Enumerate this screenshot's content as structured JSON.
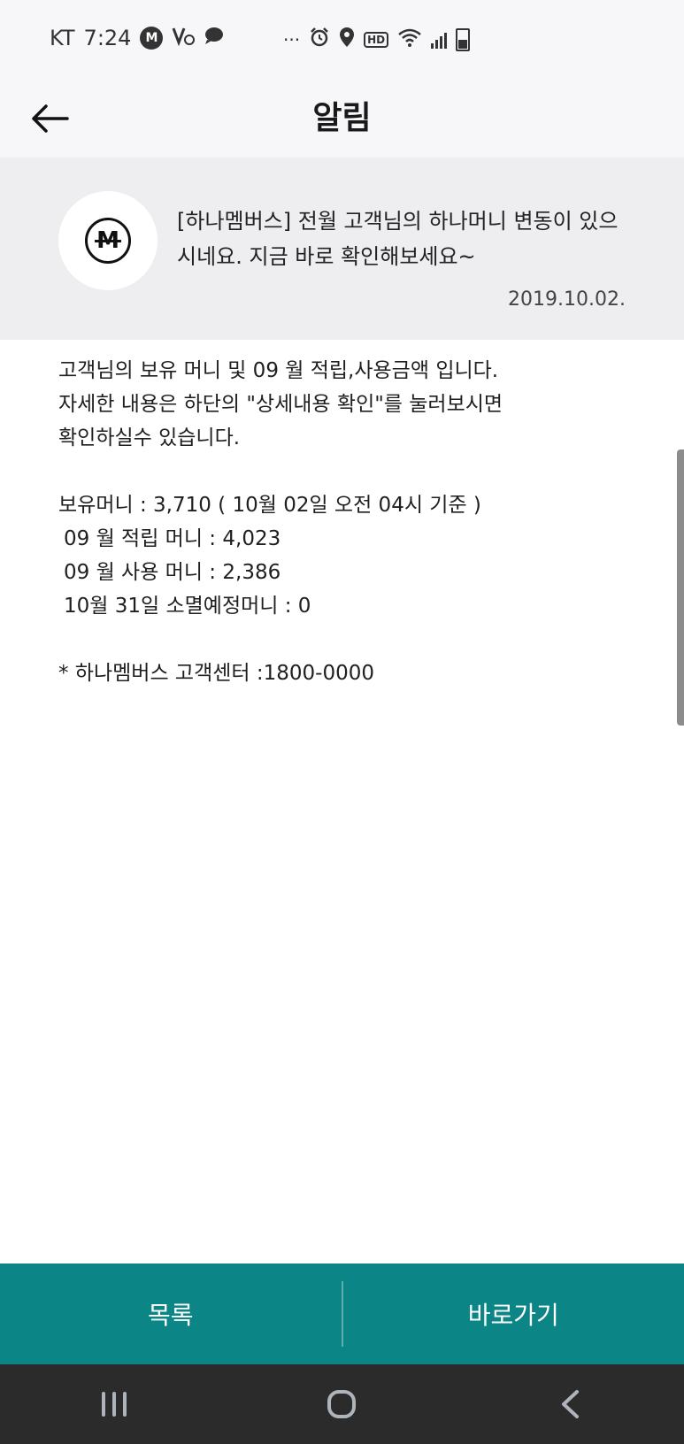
{
  "status_bar": {
    "carrier": "KT",
    "time": "7:24",
    "badge_m": "M",
    "dots": "···",
    "hd": "HD"
  },
  "header": {
    "title": "알림"
  },
  "notice": {
    "title": "[하나멤버스] 전월 고객님의 하나머니 변동이 있으시네요. 지금 바로 확인해보세요~",
    "date": "2019.10.02.",
    "logo_letter": "M"
  },
  "message": {
    "line1": "고객님의 보유 머니 및  09 월 적립,사용금액 입니다.",
    "line2": "자세한 내용은 하단의 \"상세내용 확인\"를 눌러보시면",
    "line3": "확인하실수 있습니다.",
    "balance": "보유머니 :  3,710  ( 10월 02일 오전 04시 기준 )",
    "earned": "09 월 적립 머니 :  4,023",
    "used": "09 월 사용 머니 :  2,386",
    "expiring": "10월 31일  소멸예정머니 :  0",
    "contact": "* 하나멤버스 고객센터 :1800-0000"
  },
  "actions": {
    "list_label": "목록",
    "go_label": "바로가기"
  },
  "colors": {
    "accent": "#0b8585",
    "card_bg": "#eeeef1",
    "nav_bg": "#2b2b2b"
  }
}
